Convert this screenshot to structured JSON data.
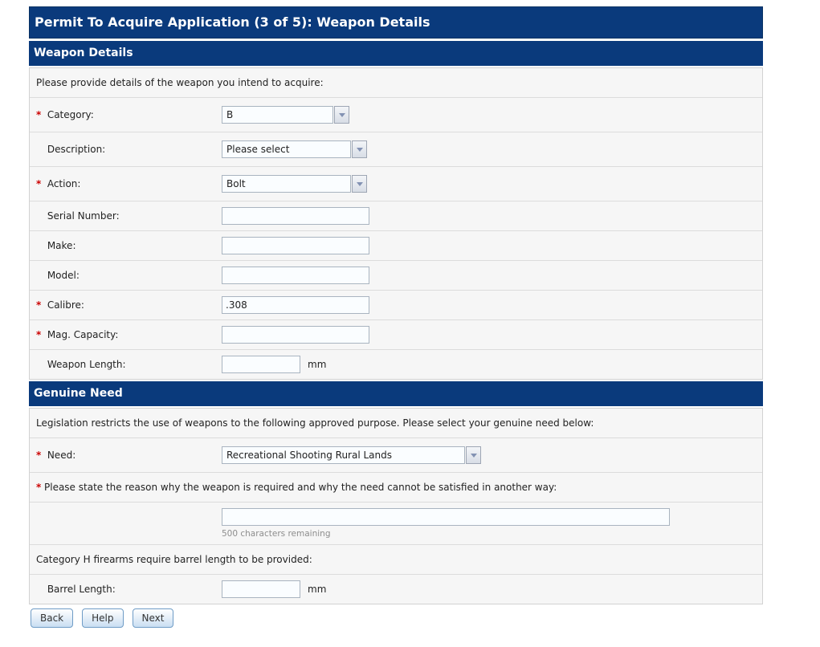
{
  "required_marker": "*",
  "colors": {
    "navy": "#0a3a7c",
    "required_red": "#cc0000"
  },
  "title_bar": "Permit To Acquire Application (3 of 5): Weapon Details",
  "weapon_details": {
    "header": "Weapon Details",
    "intro": "Please provide details of the weapon you intend to acquire:",
    "category": {
      "label": "Category:",
      "required": true,
      "value": "B"
    },
    "description": {
      "label": "Description:",
      "required": false,
      "value": "Please select"
    },
    "action": {
      "label": "Action:",
      "required": true,
      "value": "Bolt"
    },
    "serial_number": {
      "label": "Serial Number:",
      "required": false,
      "value": ""
    },
    "make": {
      "label": "Make:",
      "required": false,
      "value": ""
    },
    "model": {
      "label": "Model:",
      "required": false,
      "value": ""
    },
    "calibre": {
      "label": "Calibre:",
      "required": true,
      "value": ".308"
    },
    "mag_capacity": {
      "label": "Mag. Capacity:",
      "required": true,
      "value": ""
    },
    "weapon_length": {
      "label": "Weapon Length:",
      "required": false,
      "value": "",
      "unit": "mm"
    }
  },
  "genuine_need": {
    "header": "Genuine Need",
    "intro": "Legislation restricts the use of weapons to the following approved purpose. Please select your genuine need below:",
    "need": {
      "label": "Need:",
      "required": true,
      "value": "Recreational Shooting Rural Lands"
    },
    "reason_question": "Please state the reason why the weapon is required and why the need cannot be satisfied in another way:",
    "reason": {
      "value": "",
      "remaining": "500 characters remaining"
    },
    "category_h_note": "Category H firearms require barrel length to be provided:",
    "barrel_length": {
      "label": "Barrel Length:",
      "required": false,
      "value": "",
      "unit": "mm"
    }
  },
  "buttons": {
    "back": "Back",
    "help": "Help",
    "next": "Next"
  }
}
